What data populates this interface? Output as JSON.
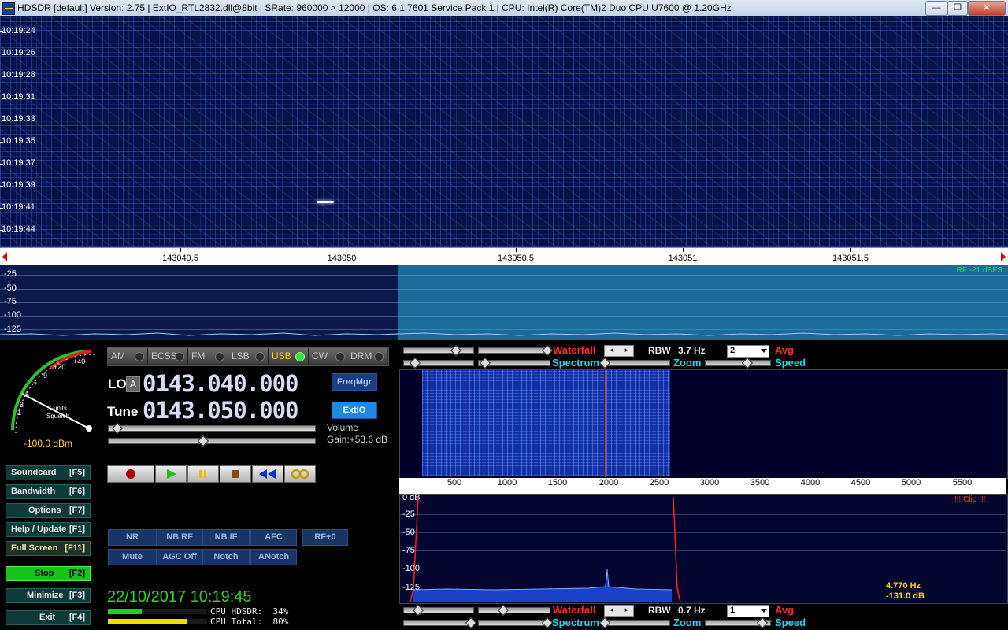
{
  "window": {
    "title": "HDSDR  [default]  Version: 2.75   |   ExtIO_RTL2832.dll@8bit   |   SRate: 960000 > 12000   |   OS: 6.1.7601  Service Pack 1   |   CPU: Intel(R) Core(TM)2 Duo CPU      U7600  @ 1.20GHz",
    "minimize": "—",
    "maximize": "❐",
    "close": "✕"
  },
  "waterfall": {
    "timestamps": [
      "10:19:24",
      "10:19:26",
      "10:19:28",
      "10:19:31",
      "10:19:33",
      "10:19:35",
      "10:19:37",
      "10:19:39",
      "10:19:41",
      "10:19:44"
    ]
  },
  "frequency_scale": {
    "labels": [
      "143049,5",
      "143050",
      "143050,5",
      "143051",
      "143051,5"
    ]
  },
  "rf_spectrum": {
    "levels": [
      "-25",
      "-50",
      "-75",
      "-100",
      "-125"
    ],
    "rf_level": "RF -21 dBFS"
  },
  "smeter": {
    "scale": [
      "1",
      "3",
      "5",
      "7",
      "9",
      "+20",
      "+40"
    ],
    "label_s_units": "S-units",
    "label_squelch": "Squelch",
    "dbm": "-100.0 dBm"
  },
  "modes": [
    {
      "label": "AM",
      "active": false
    },
    {
      "label": "ECSS",
      "active": false
    },
    {
      "label": "FM",
      "active": false
    },
    {
      "label": "LSB",
      "active": false
    },
    {
      "label": "USB",
      "active": true
    },
    {
      "label": "CW",
      "active": false
    },
    {
      "label": "DRM",
      "active": false
    }
  ],
  "lo": {
    "label": "LO",
    "vfo": "A",
    "frequency": "0143.040.000"
  },
  "tune": {
    "label": "Tune",
    "frequency": "0143.050.000"
  },
  "buttons": {
    "freqmgr": "FreqMgr",
    "extio": "ExtIO"
  },
  "volume": {
    "label": "Volume",
    "gain": "Gain:+53.6 dB"
  },
  "sidebar": [
    {
      "label": "Soundcard",
      "key": "[F5]"
    },
    {
      "label": "Bandwidth",
      "key": "[F6]"
    },
    {
      "label": "Options",
      "key": "[F7]"
    },
    {
      "label": "Help / Update",
      "key": "[F1]"
    },
    {
      "label": "Full Screen",
      "key": "[F11]"
    },
    {
      "label": "Stop",
      "key": "[F2]"
    },
    {
      "label": "Minimize",
      "key": "[F3]"
    },
    {
      "label": "Exit",
      "key": "[F4]"
    }
  ],
  "dsp": {
    "row1": [
      "NR",
      "NB RF",
      "NB IF",
      "AFC",
      "RF+0"
    ],
    "row2": [
      "Mute",
      "AGC Off",
      "Notch",
      "ANotch"
    ]
  },
  "status": {
    "datetime": "22/10/2017 10:19:45",
    "cpu_hdsdr": "CPU HDSDR:  34%",
    "cpu_total": "CPU Total:  80%",
    "cpu_hdsdr_fraction": 0.34,
    "cpu_total_fraction": 0.8
  },
  "af_top": {
    "waterfall": "Waterfall",
    "rbw_label": "RBW",
    "rbw": "3.7 Hz",
    "avg_value": "2",
    "avg": "Avg",
    "spectrum": "Spectrum",
    "zoom": "Zoom",
    "speed": "Speed"
  },
  "af_scale": [
    "500",
    "1000",
    "1500",
    "2000",
    "2500",
    "3000",
    "3500",
    "4000",
    "4500",
    "5000",
    "5500"
  ],
  "af_spectrum": {
    "levels": [
      "0 dB",
      "-25",
      "-50",
      "-75",
      "-100",
      "-125"
    ],
    "clip": "!!! Clip !!!",
    "cursor_hz": "4.770 Hz",
    "cursor_db": "-131.0 dB"
  },
  "af_bottom": {
    "waterfall": "Waterfall",
    "rbw_label": "RBW",
    "rbw": "0.7 Hz",
    "avg_value": "1",
    "avg": "Avg",
    "spectrum": "Spectrum",
    "zoom": "Zoom",
    "speed": "Speed"
  },
  "colors": {
    "accent_red": "#ff2a2a",
    "accent_cyan": "#22d3ef",
    "waterfall_bg": "#07124a",
    "active_green": "#17c51a"
  }
}
